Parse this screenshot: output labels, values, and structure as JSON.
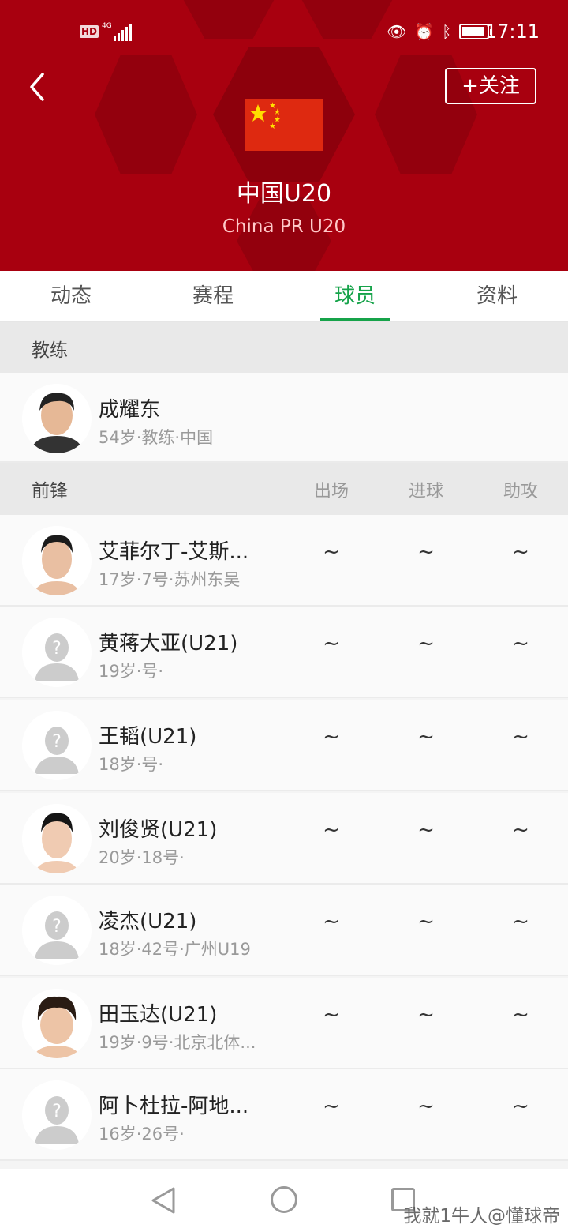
{
  "status_bar": {
    "hd": "HD",
    "network": "4G",
    "time": "17:11"
  },
  "header": {
    "follow_label": "+关注",
    "team_name": "中国U20",
    "team_name_en": "China PR U20",
    "bg_color": "#a8000f"
  },
  "tabs": [
    {
      "label": "动态"
    },
    {
      "label": "赛程"
    },
    {
      "label": "球员",
      "active": true
    },
    {
      "label": "资料"
    }
  ],
  "coach_section": {
    "title": "教练",
    "coach": {
      "name": "成耀东",
      "meta": "54岁·教练·中国"
    }
  },
  "forward_section": {
    "title": "前锋",
    "columns": [
      "出场",
      "进球",
      "助攻"
    ],
    "players": [
      {
        "name": "艾菲尔丁-艾斯...",
        "meta": "17岁·7号·苏州东吴",
        "apps": "~",
        "goals": "~",
        "assists": "~"
      },
      {
        "name": "黄蒋大亚(U21)",
        "meta": "19岁·号·",
        "apps": "~",
        "goals": "~",
        "assists": "~"
      },
      {
        "name": "王韬(U21)",
        "meta": "18岁·号·",
        "apps": "~",
        "goals": "~",
        "assists": "~"
      },
      {
        "name": "刘俊贤(U21)",
        "meta": "20岁·18号·",
        "apps": "~",
        "goals": "~",
        "assists": "~"
      },
      {
        "name": "凌杰(U21)",
        "meta": "18岁·42号·广州U19",
        "apps": "~",
        "goals": "~",
        "assists": "~"
      },
      {
        "name": "田玉达(U21)",
        "meta": "19岁·9号·北京北体...",
        "apps": "~",
        "goals": "~",
        "assists": "~"
      },
      {
        "name": "阿卜杜拉-阿地...",
        "meta": "16岁·26号·",
        "apps": "~",
        "goals": "~",
        "assists": "~"
      }
    ]
  },
  "watermark": "我就1牛人@懂球帝",
  "accent_color": "#16a34a"
}
